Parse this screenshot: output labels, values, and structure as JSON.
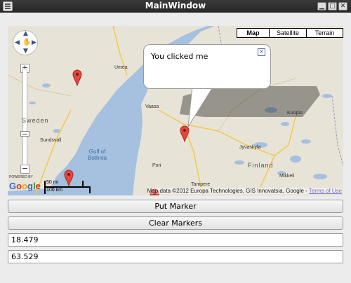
{
  "window": {
    "title": "MainWindow",
    "min_glyph": "▁",
    "max_glyph": "□",
    "close_glyph": "✕"
  },
  "map": {
    "map_types": [
      "Map",
      "Satellite",
      "Terrain"
    ],
    "selected_map_type": "Map",
    "zoom_plus": "+",
    "zoom_minus": "−",
    "info_window": {
      "text": "You clicked me",
      "close": "×"
    },
    "labels": {
      "umea": "Umea",
      "vaasa": "Vaasa",
      "kuopio": "Kuopio",
      "sweden": "Sweden",
      "sundsvall": "Sundsvall",
      "gulf_line1": "Gulf of",
      "gulf_line2": "Bothnia",
      "jyvaskyla": "Jyvaskyla",
      "finland": "Finland",
      "mikkeli": "Mikkeli",
      "pori": "Pori",
      "tampere": "Tampere"
    },
    "powered_by": "POWERED BY",
    "logo_letters": [
      "G",
      "o",
      "o",
      "g",
      "l",
      "e"
    ],
    "scale_mi": "50 mi",
    "scale_km": "100 km",
    "copyright": "Map data ©2012 Europa Technologies, GIS Innovatsia, Google - ",
    "terms_link": "Terms of Use",
    "water_color": "#a6c0df",
    "land_color": "#e8e3d7",
    "marker_color": "#e7473c"
  },
  "buttons": {
    "put_marker": "Put Marker",
    "clear_markers": "Clear Markers"
  },
  "fields": {
    "longitude": "18.479",
    "latitude": "63.529"
  }
}
